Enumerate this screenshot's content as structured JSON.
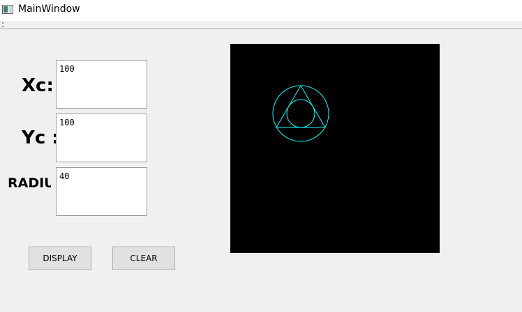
{
  "window": {
    "title": "MainWindow",
    "icon": "app-window-icon"
  },
  "form": {
    "xc_label": "Xc:",
    "yc_label": "Yc :",
    "radius_label": "RADIUS",
    "xc_value": "100",
    "yc_value": "100",
    "radius_value": "40"
  },
  "buttons": {
    "display_label": "DISPLAY",
    "clear_label": "CLEAR"
  },
  "canvas": {
    "background": "#000000",
    "stroke_color": "#00ffff"
  }
}
